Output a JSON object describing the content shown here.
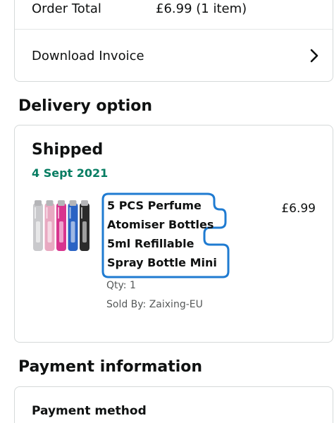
{
  "order_summary": {
    "total_label": "Order Total",
    "total_value": "£6.99 (1 item)",
    "invoice_label": "Download Invoice"
  },
  "delivery": {
    "heading": "Delivery option",
    "status": "Shipped",
    "date": "4 Sept 2021",
    "item": {
      "title_lines": [
        "5 PCS Perfume",
        "Atomiser Bottles",
        "5ml Refillable",
        "Spray Bottle Mini"
      ],
      "price": "£6.99",
      "qty": "Qty: 1",
      "seller": "Sold By: Zaixing-EU",
      "bottle_colors": [
        "#c9c9cc",
        "#e8a9c1",
        "#d8348e",
        "#2a63c4",
        "#2b2b2b"
      ]
    }
  },
  "payment": {
    "heading": "Payment information",
    "method_label": "Payment method"
  },
  "colors": {
    "delivery_date": "#067d62",
    "highlight_outline": "#1f7bd1"
  }
}
